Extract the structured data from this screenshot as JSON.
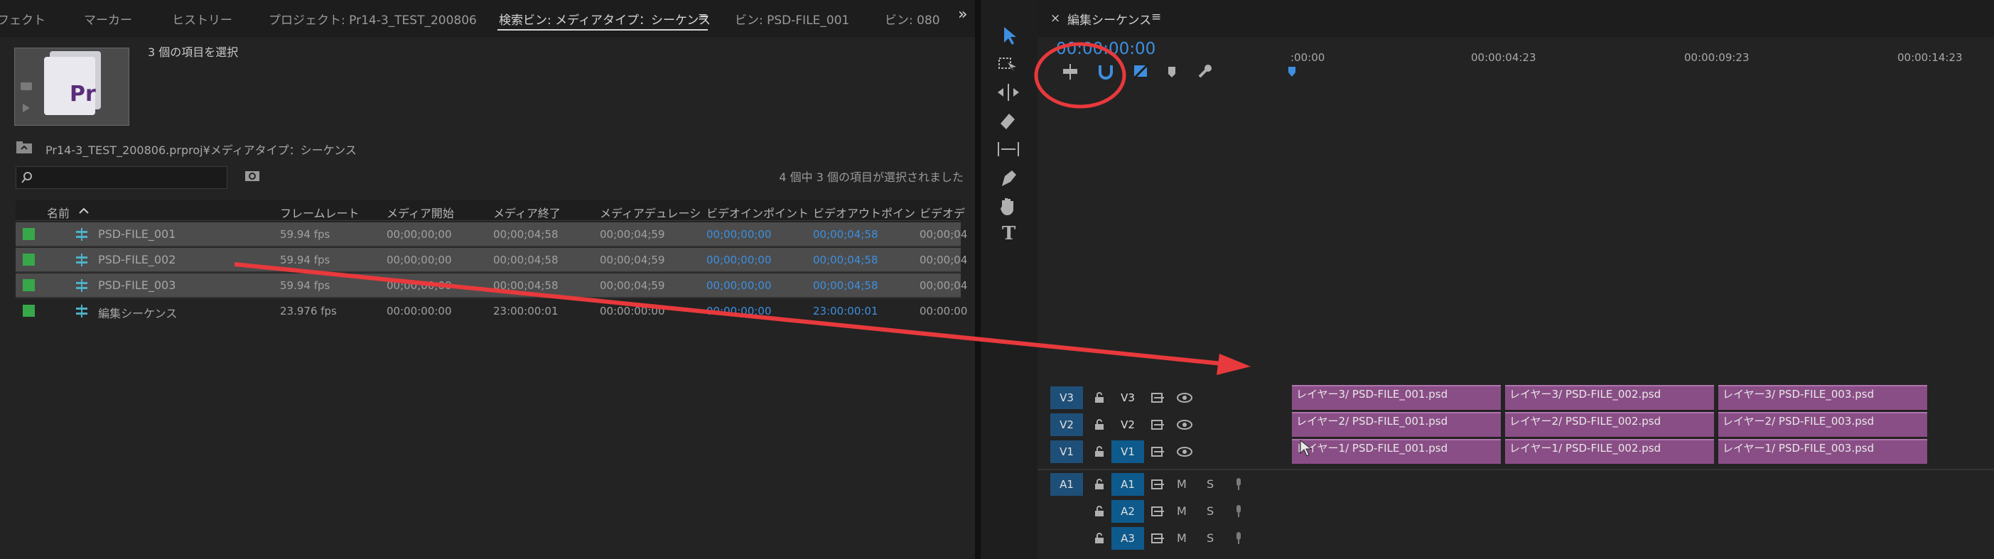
{
  "project_tabs": [
    "フェクト",
    "マーカー",
    "ヒストリー",
    "プロジェクト: Pr14-3_TEST_200806",
    "検索ビン: メディアタイプ：シーケンス",
    "ビン: PSD-FILE_001",
    "ビン: 080"
  ],
  "tab_menu_icon": "≡",
  "overflow_icon": "»",
  "selection_info": "3 個の項目を選択",
  "breadcrumb": "Pr14-3_TEST_200806.prproj¥メディアタイプ：シーケンス",
  "search": {
    "placeholder": ""
  },
  "count_info": "4 個中 3 個の項目が選択されました",
  "columns": [
    "名前",
    "フレームレート",
    "メディア開始",
    "メディア終了",
    "メディアデュレーシ",
    "ビデオインポイント",
    "ビデオアウトポイン",
    "ビデオデ"
  ],
  "rows": [
    {
      "name": "PSD-FILE_001",
      "fps": "59.94 fps",
      "start": "00;00;00;00",
      "end": "00;00;04;58",
      "dur": "00;00;04;59",
      "in": "00;00;00;00",
      "out": "00;00;04;58",
      "vd": "00;00;04",
      "selected": true
    },
    {
      "name": "PSD-FILE_002",
      "fps": "59.94 fps",
      "start": "00;00;00;00",
      "end": "00;00;04;58",
      "dur": "00;00;04;59",
      "in": "00;00;00;00",
      "out": "00;00;04;58",
      "vd": "00;00;04",
      "selected": true
    },
    {
      "name": "PSD-FILE_003",
      "fps": "59.94 fps",
      "start": "00;00;00;00",
      "end": "00;00;04;58",
      "dur": "00;00;04;59",
      "in": "00;00;00;00",
      "out": "00;00;04;58",
      "vd": "00;00;04",
      "selected": true
    },
    {
      "name": "編集シーケンス",
      "fps": "23.976 fps",
      "start": "00:00:00:00",
      "end": "23:00:00:01",
      "dur": "00:00:00:00",
      "in": "00:00:00:00",
      "out": "23:00:00:01",
      "vd": "00:00:00",
      "selected": false
    }
  ],
  "timeline": {
    "close": "×",
    "title": "編集シーケンス",
    "menu": "≡",
    "timecode": "00:00:00:00",
    "ruler": [
      ":00:00",
      "00:00:04:23",
      "00:00:09:23",
      "00:00:14:23"
    ],
    "video_tracks": [
      {
        "src": "V3",
        "label": "V3",
        "clips": [
          "レイヤー3/ PSD-FILE_001.psd",
          "レイヤー3/ PSD-FILE_002.psd",
          "レイヤー3/ PSD-FILE_003.psd"
        ]
      },
      {
        "src": "V2",
        "label": "V2",
        "clips": [
          "レイヤー2/ PSD-FILE_001.psd",
          "レイヤー2/ PSD-FILE_002.psd",
          "レイヤー2/ PSD-FILE_003.psd"
        ]
      },
      {
        "src": "V1",
        "label": "V1",
        "clips": [
          "レイヤー1/ PSD-FILE_001.psd",
          "レイヤー1/ PSD-FILE_002.psd",
          "レイヤー1/ PSD-FILE_003.psd"
        ]
      }
    ],
    "audio_tracks": [
      {
        "src": "A1",
        "label": "A1",
        "m": "M",
        "s": "S"
      },
      {
        "src": "",
        "label": "A2",
        "m": "M",
        "s": "S"
      },
      {
        "src": "",
        "label": "A3",
        "m": "M",
        "s": "S"
      }
    ]
  },
  "tools": [
    "selection-tool",
    "track-select-tool",
    "ripple-edit-tool",
    "razor-tool",
    "slip-tool",
    "pen-tool",
    "hand-tool",
    "type-tool"
  ],
  "type_tool_glyph": "T",
  "colors": {
    "accent": "#3d8fdf",
    "clip": "#8a4e86",
    "label_green": "#36a84a",
    "annotation_red": "#e8393c"
  }
}
